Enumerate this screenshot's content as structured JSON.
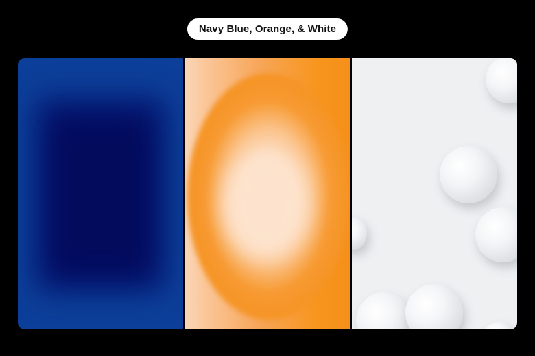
{
  "header": {
    "title": "Navy Blue, Orange, & White"
  },
  "colors": {
    "background": "#000000",
    "navy": "#04116a",
    "navy_edge": "#0c3f99",
    "orange": "#f7951d",
    "pink_ring": "#f2747d",
    "peach": "#fde3cd",
    "white_panel": "#eef0f2"
  },
  "panels": [
    {
      "name": "navy-panel"
    },
    {
      "name": "orange-panel"
    },
    {
      "name": "white-panel"
    }
  ]
}
